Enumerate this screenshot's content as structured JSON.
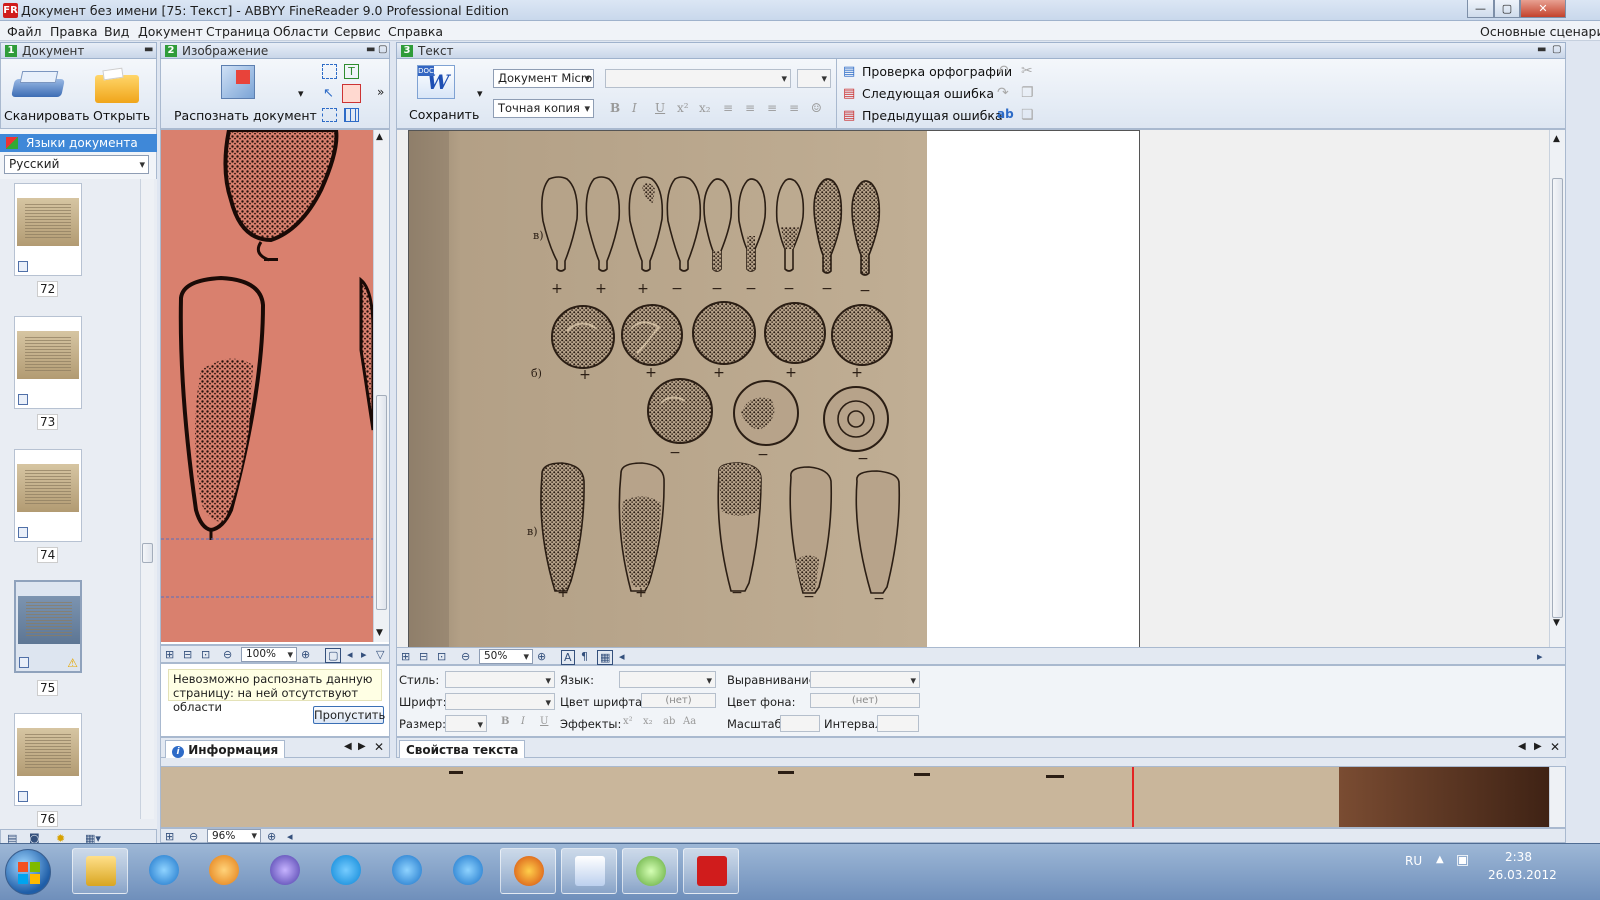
{
  "window": {
    "title": "Документ без имени [75: Текст] - ABBYY FineReader 9.0 Professional Edition",
    "app_icon": "FR",
    "min": "—",
    "max": "▢",
    "close": "✕"
  },
  "menu": {
    "items": [
      "Файл",
      "Правка",
      "Вид",
      "Документ",
      "Страница",
      "Области",
      "Сервис",
      "Справка"
    ],
    "right": "Основные сценарии"
  },
  "panes": {
    "document": {
      "num": "1",
      "title": "Документ",
      "scan": "Сканировать",
      "open": "Открыть",
      "lang_header": "Языки документа",
      "lang_value": "Русский",
      "pages": [
        "72",
        "73",
        "74",
        "75",
        "76"
      ]
    },
    "image": {
      "num": "2",
      "title": "Изображение",
      "recognize": "Распознать документ",
      "zoom": "100%",
      "warning": "Невозможно распознать данную страницу: на ней отсутствуют области",
      "skip": "Пропустить",
      "info_tab": "Информация"
    },
    "text": {
      "num": "3",
      "title": "Текст",
      "save": "Сохранить",
      "doc_format": "Документ Micro",
      "mode": "Точная копия",
      "spell": "Проверка орфографии",
      "next_err": "Следующая ошибка",
      "prev_err": "Предыдущая ошибка",
      "zoom": "50%"
    }
  },
  "props": {
    "tab": "Свойства текста",
    "style": "Стиль:",
    "lang": "Язык:",
    "align": "Выравнивание:",
    "font": "Шрифт:",
    "font_color": "Цвет шрифта:",
    "none1": "(нет)",
    "bg_color": "Цвет фона:",
    "none2": "(нет)",
    "size": "Размер:",
    "effects": "Эффекты:",
    "scale": "Масштаб:",
    "interval": "Интервал:"
  },
  "bottom": {
    "zoom": "96%"
  },
  "figure": {
    "row_a": "в)",
    "row_b": "б)",
    "row_c": "в)",
    "signs_a": [
      "+",
      "+",
      "+",
      "−",
      "−",
      "−",
      "−",
      "−",
      "−"
    ],
    "signs_b": [
      "+",
      "+",
      "+",
      "+",
      "+"
    ],
    "signs_b2": [
      "−",
      "−",
      "−"
    ],
    "signs_c": [
      "+",
      "+",
      "−",
      "−",
      "−"
    ]
  },
  "taskbar": {
    "lang": "RU",
    "time": "2:38",
    "date": "26.03.2012"
  },
  "colors": {
    "accent": "#2f9c3a",
    "image_bg": "#d9806e",
    "paper": "#b7a38a"
  }
}
